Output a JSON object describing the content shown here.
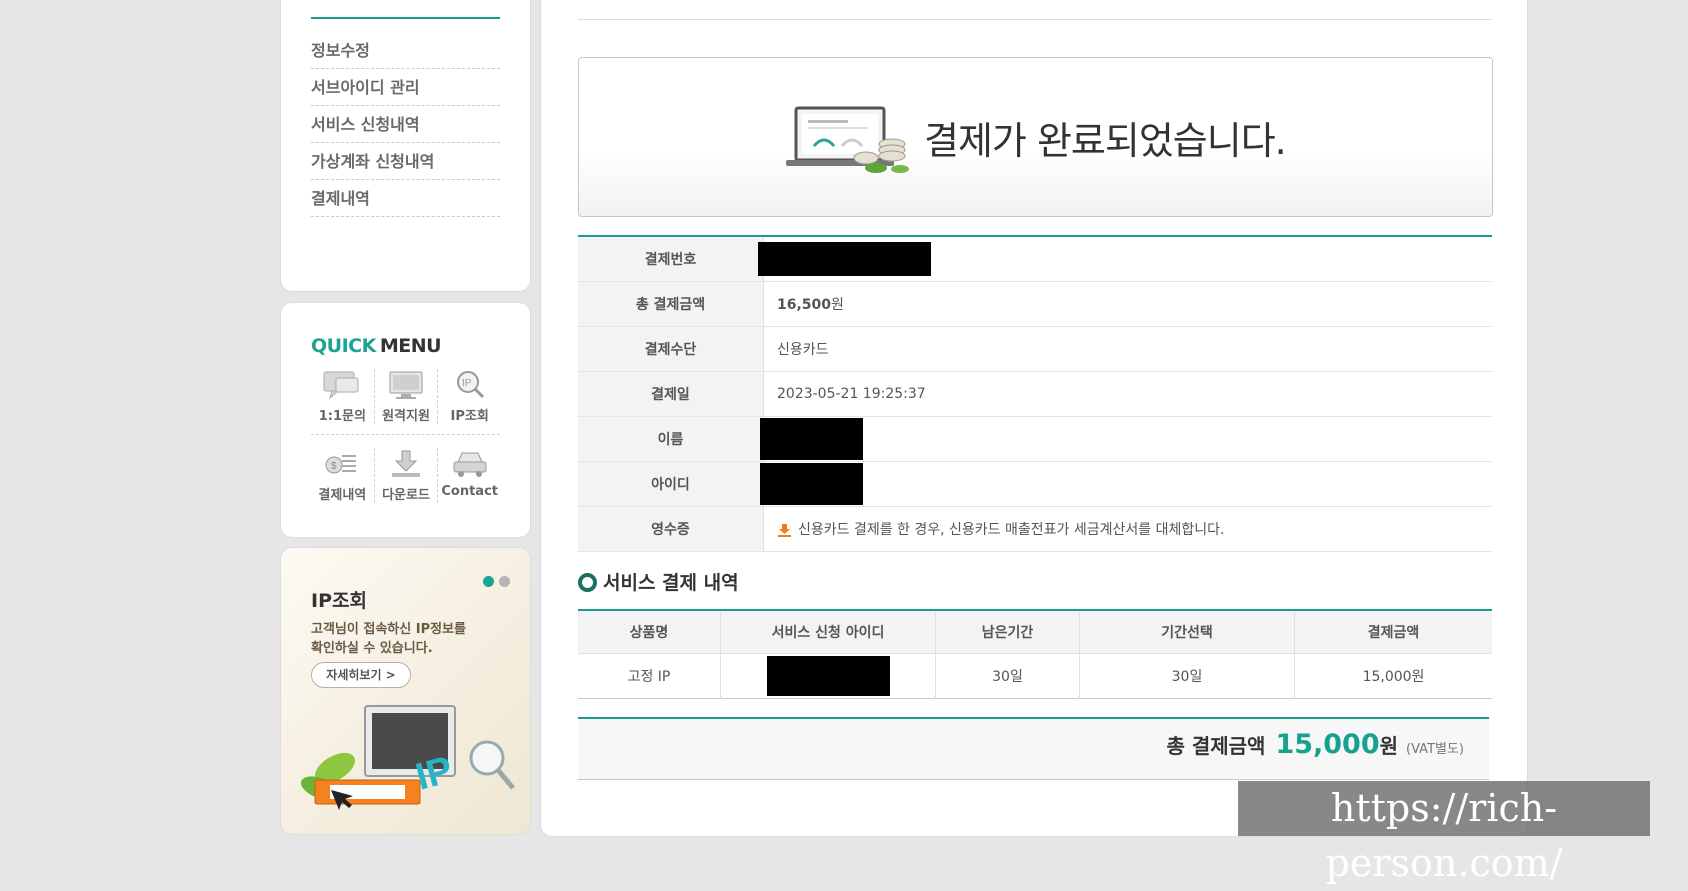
{
  "sidebar": {
    "menu_items": [
      "정보수정",
      "서브아이디 관리",
      "서비스 신청내역",
      "가상계좌 신청내역",
      "결제내역"
    ]
  },
  "quick_menu": {
    "title_part1": "QUICK",
    "title_part2": "MENU",
    "items": [
      "1:1문의",
      "원격지원",
      "IP조회",
      "결제내역",
      "다운로드",
      "Contact"
    ]
  },
  "ip_banner": {
    "title": "IP조회",
    "desc_line1": "고객님이 접속하신 IP정보를",
    "desc_line2": "확인하실 수 있습니다.",
    "more_button": "자세히보기 >"
  },
  "payment": {
    "done_message": "결제가 완료되었습니다.",
    "labels": {
      "payment_no": "결제번호",
      "total_amount": "총 결제금액",
      "method": "결제수단",
      "date": "결제일",
      "name": "이름",
      "id": "아이디",
      "receipt": "영수증"
    },
    "values": {
      "total_amount_num": "16,500",
      "total_amount_unit": "원",
      "method": "신용카드",
      "date": "2023-05-21 19:25:37",
      "receipt_note": "신용카드 결제를 한 경우, 신용카드 매출전표가 세금계산서를 대체합니다."
    }
  },
  "service": {
    "section_title": "서비스 결제 내역",
    "headers": [
      "상품명",
      "서비스 신청 아이디",
      "남은기간",
      "기간선택",
      "결제금액"
    ],
    "rows": [
      {
        "product": "고정 IP",
        "remaining": "30일",
        "period": "30일",
        "amount": "15,000원"
      }
    ]
  },
  "total": {
    "label": "총 결제금액",
    "amount": "15,000",
    "unit": "원",
    "vat": "(VAT별도)"
  },
  "watermark": "https://rich-person.com/"
}
